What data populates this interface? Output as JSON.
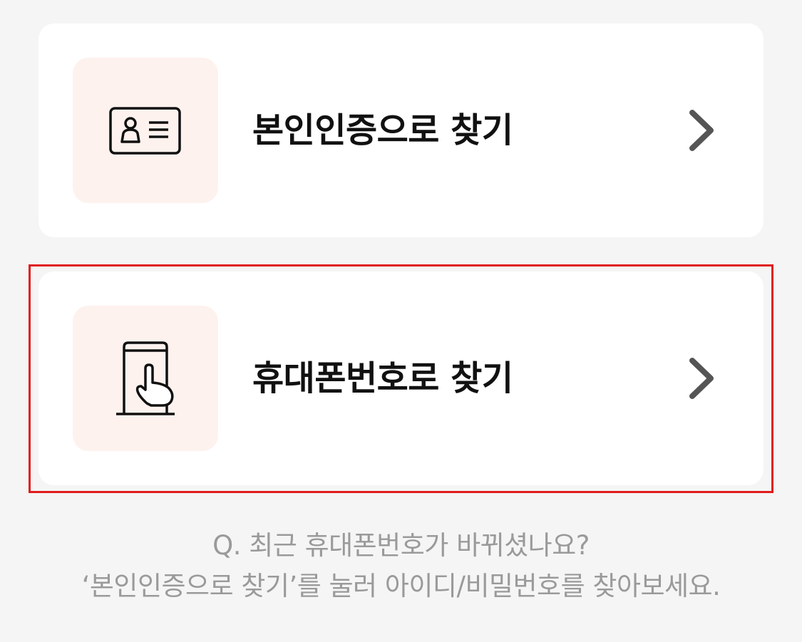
{
  "options": [
    {
      "id": "identity-verification",
      "label": "본인인증으로 찾기",
      "icon": "id-card-icon"
    },
    {
      "id": "phone-number",
      "label": "휴대폰번호로 찾기",
      "icon": "phone-touch-icon"
    }
  ],
  "help": {
    "question": "Q. 최근 휴대폰번호가 바뀌셨나요?",
    "answer": "‘본인인증으로 찾기’를 눌러 아이디/비밀번호를 찾아보세요."
  },
  "colors": {
    "background": "#f5f5f5",
    "card": "#ffffff",
    "icon_background": "#fdf2ee",
    "highlight_border": "#e01b1b",
    "help_text": "#9a9a9a"
  }
}
